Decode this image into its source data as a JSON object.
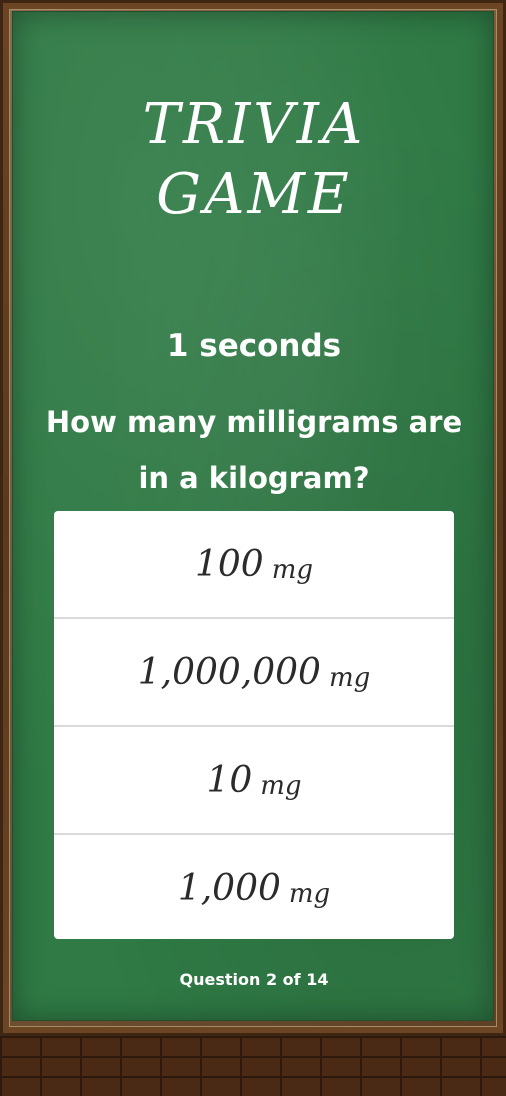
{
  "game": {
    "title_line1": "Trivia",
    "title_line2": "Game",
    "timer": "1 seconds",
    "question": "How many milligrams are in a kilogram?",
    "answers": [
      {
        "value": "100",
        "unit": "mg"
      },
      {
        "value": "1,000,000",
        "unit": "mg"
      },
      {
        "value": "10",
        "unit": "mg"
      },
      {
        "value": "1,000",
        "unit": "mg"
      }
    ],
    "progress": "Question 2 of 14"
  },
  "colors": {
    "chalkboard": "#2f7a45",
    "frame": "#6b4524",
    "chalk_text": "#ffffff",
    "answer_bg": "#ffffff",
    "answer_text": "#2b2b2b"
  }
}
